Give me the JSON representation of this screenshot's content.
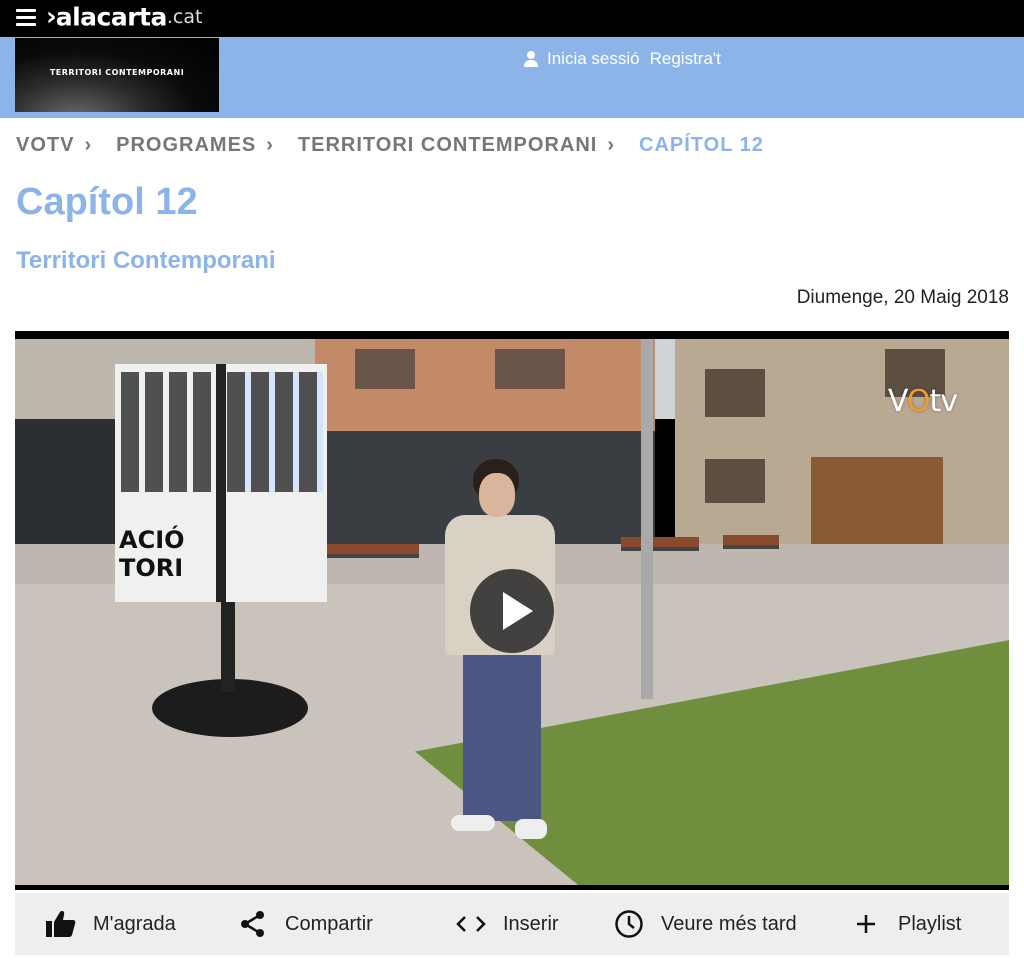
{
  "site": {
    "logo_mark": "›",
    "logo_name": "alacarta",
    "logo_tld": ".cat"
  },
  "program_thumb_text": "TERRITORI CONTEMPORANI",
  "auth": {
    "login_label": "Inicia sessió",
    "register_label": "Registra't"
  },
  "breadcrumb": {
    "items": [
      {
        "label": "VOTV"
      },
      {
        "label": "PROGRAMES"
      },
      {
        "label": "TERRITORI CONTEMPORANI"
      },
      {
        "label": "CAPÍTOL 12"
      }
    ],
    "separator": "›"
  },
  "page": {
    "title": "Capítol 12",
    "subtitle": "Territori Contemporani",
    "date": "Diumenge, 20 Maig 2018"
  },
  "video": {
    "watermark_pre": "V",
    "watermark_o": "O",
    "watermark_post": "tv",
    "poster_text_line1": "ACIÓ",
    "poster_text_line2": "TORI"
  },
  "actions": [
    {
      "label": "M'agrada",
      "icon": "thumbs-up-icon"
    },
    {
      "label": "Compartir",
      "icon": "share-icon"
    },
    {
      "label": "Inserir",
      "icon": "code-icon"
    },
    {
      "label": "Veure més tard",
      "icon": "clock-icon"
    },
    {
      "label": "Playlist",
      "icon": "plus-icon"
    }
  ],
  "colors": {
    "accent": "#8db4e8",
    "topbar": "#000000",
    "action_bar": "#eeeeee"
  }
}
